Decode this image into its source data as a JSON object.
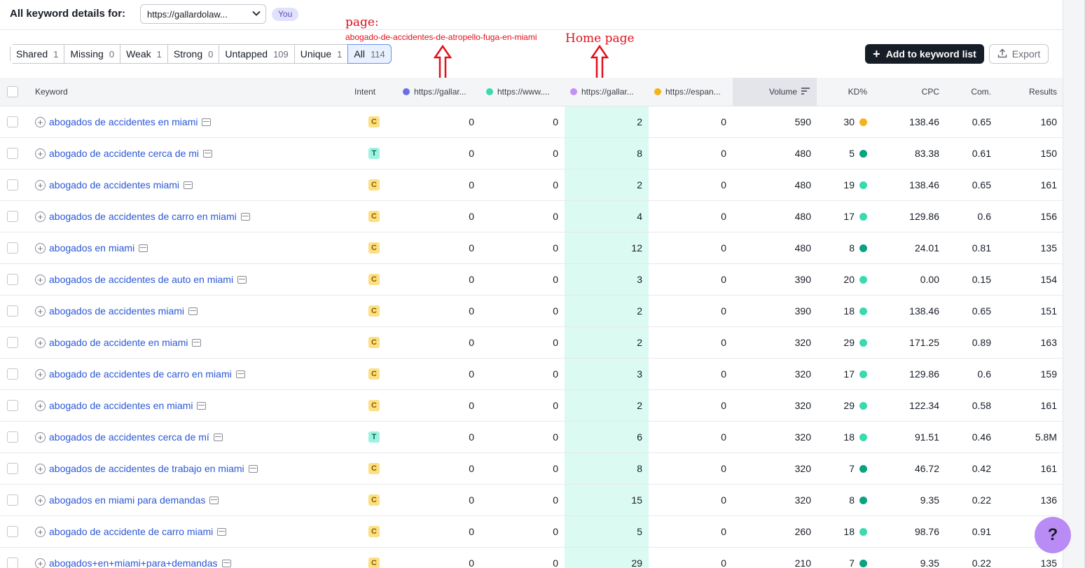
{
  "header": {
    "title": "All keyword details for:",
    "domain_select_value": "https://gallardolaw...",
    "you_badge": "You"
  },
  "filter_tabs": [
    {
      "label": "Shared",
      "count": "1"
    },
    {
      "label": "Missing",
      "count": "0"
    },
    {
      "label": "Weak",
      "count": "1"
    },
    {
      "label": "Strong",
      "count": "0"
    },
    {
      "label": "Untapped",
      "count": "109"
    },
    {
      "label": "Unique",
      "count": "1"
    },
    {
      "label": "All",
      "count": "114",
      "active": true
    }
  ],
  "actions": {
    "add_to_list": "Add to keyword list",
    "export": "Export"
  },
  "annotations": {
    "page_label": "page:",
    "page_url": "abogado-de-accidentes-de-atropello-fuga-en-miami",
    "home_label": "Home page",
    "color": "#e0101b"
  },
  "columns": {
    "keyword": "Keyword",
    "intent": "Intent",
    "domain1": "https://gallar...",
    "domain2": "https://www....",
    "domain3": "https://gallar...",
    "domain4": "https://espan...",
    "volume": "Volume",
    "kd": "KD%",
    "cpc": "CPC",
    "com": "Com.",
    "results": "Results"
  },
  "domain_colors": [
    "#6b6fe6",
    "#3ad9b0",
    "#c48ff7",
    "#f5b21b"
  ],
  "intent_colors": {
    "C": {
      "bg": "#fce081",
      "fg": "#8a5c00"
    },
    "T": {
      "bg": "#9ff2df",
      "fg": "#0a6a55"
    }
  },
  "kd_colors": {
    "yellow": "#f5b21b",
    "light_green": "#3ad9b0",
    "dark_green": "#0aa37f"
  },
  "rows": [
    {
      "keyword": "abogados de accidentes en miami",
      "intent": "C",
      "d1": "0",
      "d2": "0",
      "d3": "2",
      "d4": "0",
      "volume": "590",
      "kd": "30",
      "kd_color": "yellow",
      "cpc": "138.46",
      "com": "0.65",
      "results": "160"
    },
    {
      "keyword": "abogado de accidente cerca de mi",
      "intent": "T",
      "d1": "0",
      "d2": "0",
      "d3": "8",
      "d4": "0",
      "volume": "480",
      "kd": "5",
      "kd_color": "dark_green",
      "cpc": "83.38",
      "com": "0.61",
      "results": "150"
    },
    {
      "keyword": "abogado de accidentes miami",
      "intent": "C",
      "d1": "0",
      "d2": "0",
      "d3": "2",
      "d4": "0",
      "volume": "480",
      "kd": "19",
      "kd_color": "light_green",
      "cpc": "138.46",
      "com": "0.65",
      "results": "161"
    },
    {
      "keyword": "abogados de accidentes de carro en miami",
      "intent": "C",
      "d1": "0",
      "d2": "0",
      "d3": "4",
      "d4": "0",
      "volume": "480",
      "kd": "17",
      "kd_color": "light_green",
      "cpc": "129.86",
      "com": "0.6",
      "results": "156"
    },
    {
      "keyword": "abogados en miami",
      "intent": "C",
      "d1": "0",
      "d2": "0",
      "d3": "12",
      "d4": "0",
      "volume": "480",
      "kd": "8",
      "kd_color": "dark_green",
      "cpc": "24.01",
      "com": "0.81",
      "results": "135"
    },
    {
      "keyword": "abogados de accidentes de auto en miami",
      "intent": "C",
      "d1": "0",
      "d2": "0",
      "d3": "3",
      "d4": "0",
      "volume": "390",
      "kd": "20",
      "kd_color": "light_green",
      "cpc": "0.00",
      "com": "0.15",
      "results": "154"
    },
    {
      "keyword": "abogados de accidentes miami",
      "intent": "C",
      "d1": "0",
      "d2": "0",
      "d3": "2",
      "d4": "0",
      "volume": "390",
      "kd": "18",
      "kd_color": "light_green",
      "cpc": "138.46",
      "com": "0.65",
      "results": "151"
    },
    {
      "keyword": "abogado de accidente en miami",
      "intent": "C",
      "d1": "0",
      "d2": "0",
      "d3": "2",
      "d4": "0",
      "volume": "320",
      "kd": "29",
      "kd_color": "light_green",
      "cpc": "171.25",
      "com": "0.89",
      "results": "163"
    },
    {
      "keyword": "abogado de accidentes de carro en miami",
      "intent": "C",
      "d1": "0",
      "d2": "0",
      "d3": "3",
      "d4": "0",
      "volume": "320",
      "kd": "17",
      "kd_color": "light_green",
      "cpc": "129.86",
      "com": "0.6",
      "results": "159"
    },
    {
      "keyword": "abogado de accidentes en miami",
      "intent": "C",
      "d1": "0",
      "d2": "0",
      "d3": "2",
      "d4": "0",
      "volume": "320",
      "kd": "29",
      "kd_color": "light_green",
      "cpc": "122.34",
      "com": "0.58",
      "results": "161"
    },
    {
      "keyword": "abogados de accidentes cerca de mí",
      "intent": "T",
      "d1": "0",
      "d2": "0",
      "d3": "6",
      "d4": "0",
      "volume": "320",
      "kd": "18",
      "kd_color": "light_green",
      "cpc": "91.51",
      "com": "0.46",
      "results": "5.8M"
    },
    {
      "keyword": "abogados de accidentes de trabajo en miami",
      "intent": "C",
      "d1": "0",
      "d2": "0",
      "d3": "8",
      "d4": "0",
      "volume": "320",
      "kd": "7",
      "kd_color": "dark_green",
      "cpc": "46.72",
      "com": "0.42",
      "results": "161"
    },
    {
      "keyword": "abogados en miami para demandas",
      "intent": "C",
      "d1": "0",
      "d2": "0",
      "d3": "15",
      "d4": "0",
      "volume": "320",
      "kd": "8",
      "kd_color": "dark_green",
      "cpc": "9.35",
      "com": "0.22",
      "results": "136"
    },
    {
      "keyword": "abogado de accidente de carro miami",
      "intent": "C",
      "d1": "0",
      "d2": "0",
      "d3": "5",
      "d4": "0",
      "volume": "260",
      "kd": "18",
      "kd_color": "light_green",
      "cpc": "98.76",
      "com": "0.91",
      "results": ""
    },
    {
      "keyword": "abogados+en+miami+para+demandas",
      "intent": "C",
      "d1": "0",
      "d2": "0",
      "d3": "29",
      "d4": "0",
      "volume": "210",
      "kd": "7",
      "kd_color": "dark_green",
      "cpc": "9.35",
      "com": "0.22",
      "results": "135"
    }
  ],
  "help_button": "?"
}
